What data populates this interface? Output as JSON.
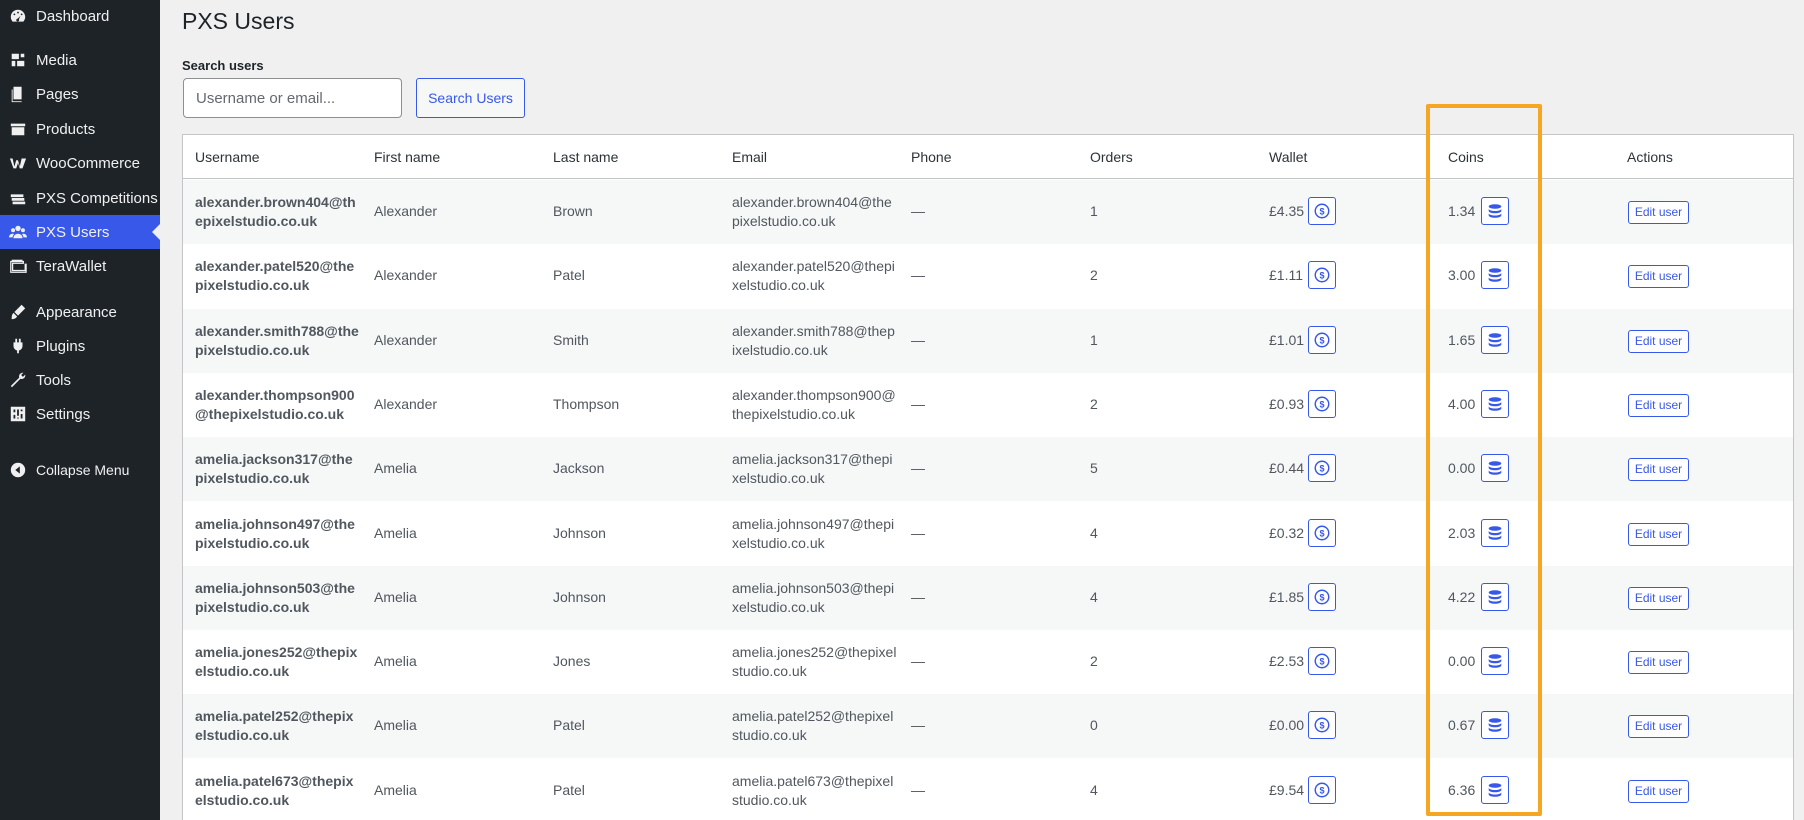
{
  "sidebar": {
    "items": [
      {
        "label": "Dashboard",
        "icon": "dashboard-icon"
      },
      {
        "label": "Media",
        "icon": "media-icon"
      },
      {
        "label": "Pages",
        "icon": "pages-icon"
      },
      {
        "label": "Products",
        "icon": "products-icon"
      },
      {
        "label": "WooCommerce",
        "icon": "woocommerce-icon"
      },
      {
        "label": "PXS Competitions",
        "icon": "competitions-icon"
      },
      {
        "label": "PXS Users",
        "icon": "users-icon",
        "active": true
      },
      {
        "label": "TeraWallet",
        "icon": "wallet-icon"
      },
      {
        "label": "Appearance",
        "icon": "appearance-icon"
      },
      {
        "label": "Plugins",
        "icon": "plugins-icon"
      },
      {
        "label": "Tools",
        "icon": "tools-icon"
      },
      {
        "label": "Settings",
        "icon": "settings-icon"
      },
      {
        "label": "Collapse Menu",
        "icon": "collapse-icon"
      }
    ]
  },
  "page": {
    "title": "PXS Users",
    "search_label": "Search users",
    "search_placeholder": "Username or email...",
    "search_button": "Search Users"
  },
  "table": {
    "columns": [
      "Username",
      "First name",
      "Last name",
      "Email",
      "Phone",
      "Orders",
      "Wallet",
      "Coins",
      "Actions"
    ],
    "edit_label": "Edit user",
    "rows": [
      {
        "username": "alexander.brown404@thepixelstudio.co.uk",
        "first": "Alexander",
        "last": "Brown",
        "email": "alexander.brown404@thepixelstudio.co.uk",
        "phone": "—",
        "orders": "1",
        "wallet": "£4.35",
        "coins": "1.34"
      },
      {
        "username": "alexander.patel520@thepixelstudio.co.uk",
        "first": "Alexander",
        "last": "Patel",
        "email": "alexander.patel520@thepixelstudio.co.uk",
        "phone": "—",
        "orders": "2",
        "wallet": "£1.11",
        "coins": "3.00"
      },
      {
        "username": "alexander.smith788@thepixelstudio.co.uk",
        "first": "Alexander",
        "last": "Smith",
        "email": "alexander.smith788@thepixelstudio.co.uk",
        "phone": "—",
        "orders": "1",
        "wallet": "£1.01",
        "coins": "1.65"
      },
      {
        "username": "alexander.thompson900@thepixelstudio.co.uk",
        "first": "Alexander",
        "last": "Thompson",
        "email": "alexander.thompson900@thepixelstudio.co.uk",
        "phone": "—",
        "orders": "2",
        "wallet": "£0.93",
        "coins": "4.00"
      },
      {
        "username": "amelia.jackson317@thepixelstudio.co.uk",
        "first": "Amelia",
        "last": "Jackson",
        "email": "amelia.jackson317@thepixelstudio.co.uk",
        "phone": "—",
        "orders": "5",
        "wallet": "£0.44",
        "coins": "0.00"
      },
      {
        "username": "amelia.johnson497@thepixelstudio.co.uk",
        "first": "Amelia",
        "last": "Johnson",
        "email": "amelia.johnson497@thepixelstudio.co.uk",
        "phone": "—",
        "orders": "4",
        "wallet": "£0.32",
        "coins": "2.03"
      },
      {
        "username": "amelia.johnson503@thepixelstudio.co.uk",
        "first": "Amelia",
        "last": "Johnson",
        "email": "amelia.johnson503@thepixelstudio.co.uk",
        "phone": "—",
        "orders": "4",
        "wallet": "£1.85",
        "coins": "4.22"
      },
      {
        "username": "amelia.jones252@thepixelstudio.co.uk",
        "first": "Amelia",
        "last": "Jones",
        "email": "amelia.jones252@thepixelstudio.co.uk",
        "phone": "—",
        "orders": "2",
        "wallet": "£2.53",
        "coins": "0.00"
      },
      {
        "username": "amelia.patel252@thepixelstudio.co.uk",
        "first": "Amelia",
        "last": "Patel",
        "email": "amelia.patel252@thepixelstudio.co.uk",
        "phone": "—",
        "orders": "0",
        "wallet": "£0.00",
        "coins": "0.67"
      },
      {
        "username": "amelia.patel673@thepixelstudio.co.uk",
        "first": "Amelia",
        "last": "Patel",
        "email": "amelia.patel673@thepixelstudio.co.uk",
        "phone": "—",
        "orders": "4",
        "wallet": "£9.54",
        "coins": "6.36"
      }
    ]
  },
  "colors": {
    "accent": "#3858e9",
    "highlight": "#f5a623",
    "sidebar_bg": "#1d2327"
  }
}
